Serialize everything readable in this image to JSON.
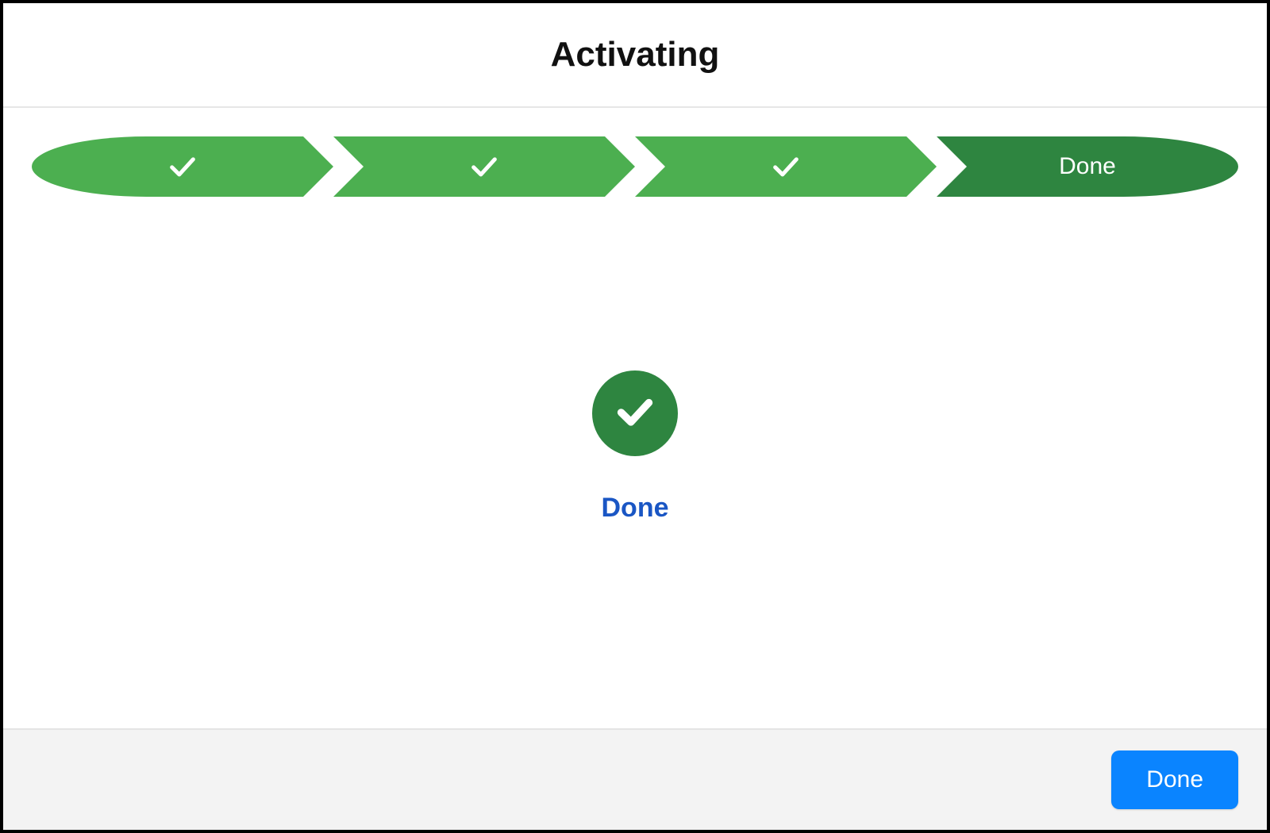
{
  "header": {
    "title": "Activating"
  },
  "stepper": {
    "steps": [
      {
        "state": "complete",
        "label": ""
      },
      {
        "state": "complete",
        "label": ""
      },
      {
        "state": "complete",
        "label": ""
      },
      {
        "state": "active",
        "label": "Done"
      }
    ],
    "colors": {
      "complete": "#4caf50",
      "active": "#2e8540"
    }
  },
  "status": {
    "icon": "check-icon",
    "label": "Done",
    "label_color": "#1a56c4",
    "badge_color": "#2e8540"
  },
  "footer": {
    "done_label": "Done"
  }
}
